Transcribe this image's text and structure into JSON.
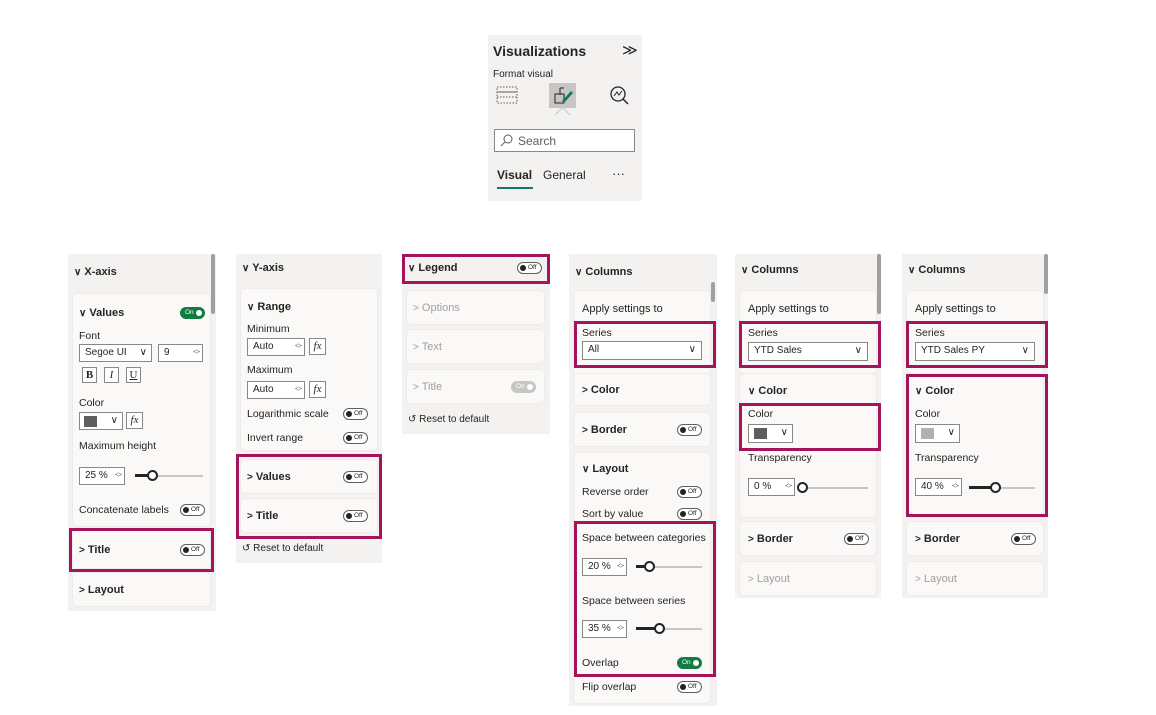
{
  "viz": {
    "title": "Visualizations",
    "expand_glyph": "≫",
    "subtitle": "Format visual",
    "search_placeholder": "Search",
    "tab_visual": "Visual",
    "tab_general": "General",
    "more": "···"
  },
  "xaxis": {
    "header": "X-axis",
    "values_label": "Values",
    "values_toggle": "On",
    "font_label": "Font",
    "font_family": "Segoe UI",
    "font_size": "9",
    "bold": "B",
    "italic": "I",
    "underline": "U",
    "color_label": "Color",
    "fx": "fx",
    "max_height_label": "Maximum height",
    "max_height_value": "25 %",
    "max_height_level": 0.25,
    "concat_label": "Concatenate labels",
    "concat_toggle": "Off",
    "title_label": "Title",
    "title_toggle": "Off",
    "layout_label": "Layout"
  },
  "yaxis": {
    "header": "Y-axis",
    "range_label": "Range",
    "min_label": "Minimum",
    "min_value": "Auto",
    "max_label": "Maximum",
    "max_value": "Auto",
    "fx": "fx",
    "log_label": "Logarithmic scale",
    "log_toggle": "Off",
    "invert_label": "Invert range",
    "invert_toggle": "Off",
    "values_label": "Values",
    "values_toggle": "Off",
    "title_label": "Title",
    "title_toggle": "Off",
    "reset_label": "Reset to default"
  },
  "legend": {
    "header": "Legend",
    "header_toggle": "Off",
    "options_label": "Options",
    "text_label": "Text",
    "title_label": "Title",
    "title_toggle": "On",
    "reset_label": "Reset to default"
  },
  "columns1": {
    "header": "Columns",
    "apply_label": "Apply settings to",
    "series_label": "Series",
    "series_value": "All",
    "color_label": "Color",
    "border_label": "Border",
    "border_toggle": "Off",
    "layout_label": "Layout",
    "reverse_label": "Reverse order",
    "reverse_toggle": "Off",
    "sort_label": "Sort by value",
    "sort_toggle": "Off",
    "space_cat_label": "Space between categories",
    "space_cat_value": "20 %",
    "space_cat_level": 0.2,
    "space_series_label": "Space between series",
    "space_series_value": "35 %",
    "space_series_level": 0.35,
    "overlap_label": "Overlap",
    "overlap_toggle": "On",
    "flip_label": "Flip overlap",
    "flip_toggle": "Off"
  },
  "columns2": {
    "header": "Columns",
    "apply_label": "Apply settings to",
    "series_label": "Series",
    "series_value": "YTD Sales",
    "color_section": "Color",
    "color_label": "Color",
    "transparency_label": "Transparency",
    "transparency_value": "0 %",
    "transparency_level": 0,
    "border_label": "Border",
    "border_toggle": "Off",
    "layout_label": "Layout"
  },
  "columns3": {
    "header": "Columns",
    "apply_label": "Apply settings to",
    "series_label": "Series",
    "series_value": "YTD Sales PY",
    "color_section": "Color",
    "color_label": "Color",
    "transparency_label": "Transparency",
    "transparency_value": "40 %",
    "transparency_level": 0.4,
    "border_label": "Border",
    "border_toggle": "Off",
    "layout_label": "Layout"
  },
  "colors": {
    "highlight": "#a4145a",
    "toggle_on": "#107c41",
    "swatch_dark": "#605e5c",
    "swatch_light": "#b3b0ad"
  },
  "icons": [
    "build-visual-icon",
    "format-paintbrush-icon",
    "analytics-magnifier-icon",
    "search-icon",
    "chevron-down-icon",
    "chevron-right-icon",
    "reset-icon"
  ]
}
